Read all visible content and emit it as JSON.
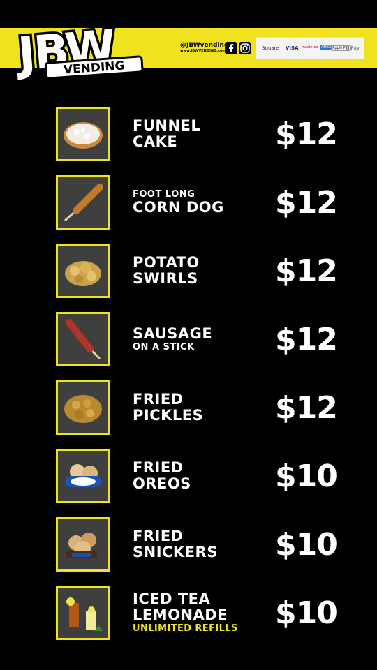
{
  "brand": {
    "logo_text": "JBW",
    "logo_sub": "VENDING",
    "handle": "@JBWvending",
    "website": "www.JBWVENDING.com"
  },
  "header": {
    "social_icons": [
      "facebook-icon",
      "instagram-icon"
    ],
    "payments": [
      "Square",
      "VISA",
      "mastercard",
      "AMEX",
      "Apple Pay",
      "G Pay"
    ]
  },
  "menu": [
    {
      "lines": [
        "FUNNEL",
        "CAKE"
      ],
      "price": "$12",
      "icon": "funnel-cake-icon"
    },
    {
      "small_top": "FOOT LONG",
      "lines": [
        "CORN DOG"
      ],
      "price": "$12",
      "icon": "corn-dog-icon"
    },
    {
      "lines": [
        "POTATO",
        "SWIRLS"
      ],
      "price": "$12",
      "icon": "potato-swirls-icon"
    },
    {
      "lines": [
        "SAUSAGE"
      ],
      "small_bottom": "ON A STICK",
      "price": "$12",
      "icon": "sausage-icon"
    },
    {
      "lines": [
        "FRIED",
        "PICKLES"
      ],
      "price": "$12",
      "icon": "fried-pickles-icon"
    },
    {
      "lines": [
        "FRIED",
        "OREOS"
      ],
      "price": "$10",
      "icon": "fried-oreos-icon"
    },
    {
      "lines": [
        "FRIED",
        "SNICKERS"
      ],
      "price": "$10",
      "icon": "fried-snickers-icon"
    },
    {
      "lines": [
        "ICED TEA",
        "LEMONADE"
      ],
      "note": "UNLIMITED REFILLS",
      "price": "$10",
      "icon": "drinks-icon"
    }
  ],
  "colors": {
    "accent": "#f0e21c",
    "background": "#000000",
    "tile": "#3f3f3f",
    "text": "#ffffff"
  }
}
